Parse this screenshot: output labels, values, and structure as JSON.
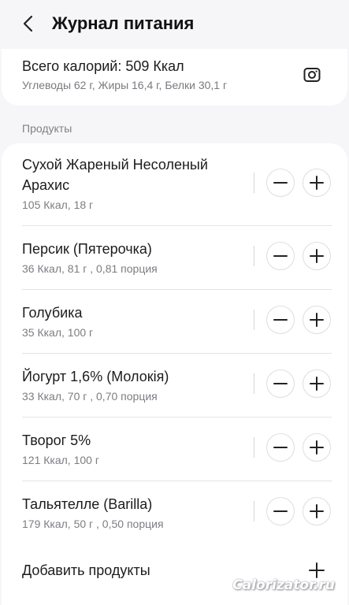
{
  "header": {
    "title": "Журнал питания",
    "back_icon": "chevron-left-icon"
  },
  "summary": {
    "title": "Всего калорий: 509 Ккал",
    "macros": "Углеводы 62 г, Жиры 16,4 г, Белки 30,1 г",
    "camera_icon": "camera-icon"
  },
  "section": {
    "label": "Продукты"
  },
  "foods": [
    {
      "name": "Сухой Жареный Несоленый Арахис",
      "meta": "105 Ккал, 18 г"
    },
    {
      "name": "Персик (Пятерочка)",
      "meta": "36 Ккал, 81 г , 0,81 порция"
    },
    {
      "name": "Голубика",
      "meta": "35 Ккал, 100 г"
    },
    {
      "name": "Йогурт 1,6% (Молокія)",
      "meta": "33 Ккал, 70 г , 0,70 порция"
    },
    {
      "name": "Творог 5%",
      "meta": "121 Ккал, 100 г"
    },
    {
      "name": "Тальятелле (Barilla)",
      "meta": "179 Ккал, 50 г , 0,50 порция"
    }
  ],
  "add": {
    "label": "Добавить продукты"
  },
  "watermark": "Calorizator.ru"
}
